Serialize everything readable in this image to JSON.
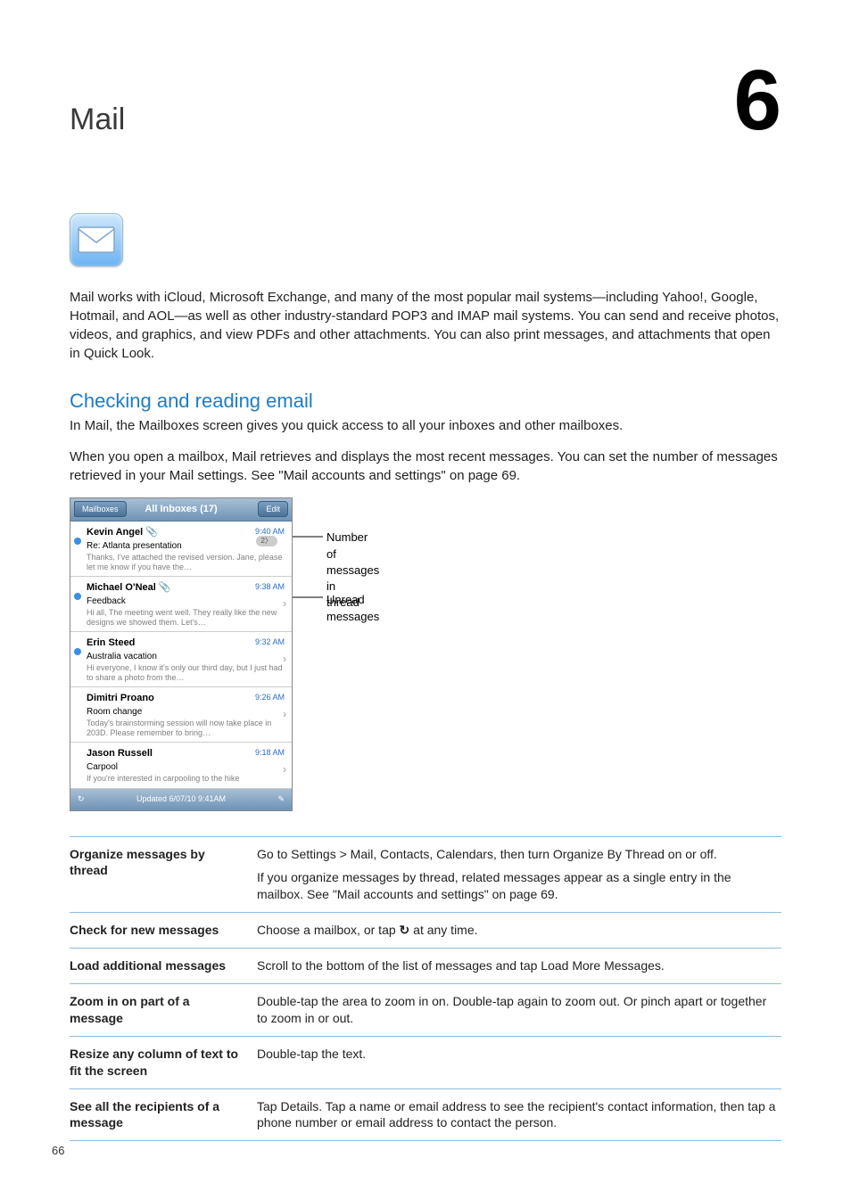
{
  "chapter": {
    "title": "Mail",
    "number": "6"
  },
  "intro": "Mail works with iCloud, Microsoft Exchange, and many of the most popular mail systems—including Yahoo!, Google, Hotmail, and AOL—as well as other industry-standard POP3 and IMAP mail systems. You can send and receive photos, videos, and graphics, and view PDFs and other attachments. You can also print messages, and attachments that open in Quick Look.",
  "section": {
    "heading": "Checking and reading email",
    "sub": "In Mail, the Mailboxes screen gives you quick access to all your inboxes and other mailboxes.",
    "para": "When you open a mailbox, Mail retrieves and displays the most recent messages. You can set the number of messages retrieved in your Mail settings. See \"Mail accounts and settings\" on page 69."
  },
  "phone": {
    "back": "Mailboxes",
    "title": "All Inboxes (17)",
    "edit": "Edit",
    "status": "Updated 6/07/10 9:41AM",
    "messages": [
      {
        "sender": "Kevin Angel",
        "attachment": true,
        "time": "9:40 AM",
        "subject": "Re: Atlanta presentation",
        "preview": "Thanks, I've attached the revised version. Jane, please let me know if you have the…",
        "unread": true,
        "thread": "2"
      },
      {
        "sender": "Michael O'Neal",
        "attachment": true,
        "time": "9:38 AM",
        "subject": "Feedback",
        "preview": "Hi all, The meeting went well. They really like the new designs we showed them. Let's…",
        "unread": true
      },
      {
        "sender": "Erin Steed",
        "time": "9:32 AM",
        "subject": "Australia vacation",
        "preview": "Hi everyone, I know it's only our third day, but I just had to share a photo from the…",
        "unread": true
      },
      {
        "sender": "Dimitri Proano",
        "time": "9:26 AM",
        "subject": "Room change",
        "preview": "Today's brainstorming session will now take place in 203D. Please remember to bring…"
      },
      {
        "sender": "Jason Russell",
        "time": "9:18 AM",
        "subject": "Carpool",
        "preview": "If you're interested in carpooling to the hike"
      }
    ]
  },
  "callouts": {
    "c1a": "Number of",
    "c1b": "messages in",
    "c1c": "thread",
    "c2": "Unread messages"
  },
  "tasks": [
    {
      "left": "Organize messages by thread",
      "right": "Go to Settings > Mail, Contacts, Calendars, then turn Organize By Thread on or off.\nIf you organize messages by thread, related messages appear as a single entry in the mailbox. See \"Mail accounts and settings\" on page 69."
    },
    {
      "left": "Check for new messages",
      "right_pre": "Choose a mailbox, or tap ",
      "right_post": " at any time.",
      "glyph": "↻"
    },
    {
      "left": "Load additional messages",
      "right": "Scroll to the bottom of the list of messages and tap Load More Messages."
    },
    {
      "left": "Zoom in on part of a message",
      "right": "Double-tap the area to zoom in on. Double-tap again to zoom out. Or pinch apart or together to zoom in or out."
    },
    {
      "left": "Resize any column of text to fit the screen",
      "right": "Double-tap the text."
    },
    {
      "left": "See all the recipients of a message",
      "right": "Tap Details. Tap a name or email address to see the recipient's contact information, then tap a phone number or email address to contact the person."
    }
  ],
  "pageNumber": "66"
}
